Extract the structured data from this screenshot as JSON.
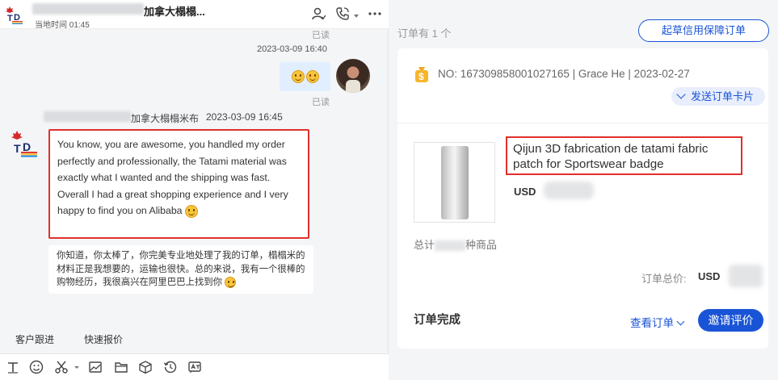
{
  "chat": {
    "header": {
      "contact_name": "加拿大榻榻...",
      "local_time": "当地时间 01:45",
      "icons": [
        "add-contact-icon",
        "call-icon",
        "more-icon"
      ]
    },
    "messages": {
      "read_top": "已读",
      "own_time": "2023-03-09 16:40",
      "read_own": "已读",
      "buyer_name": "加拿大榻榻米布",
      "buyer_time": "2023-03-09 16:45",
      "buyer_text": "You know, you are awesome, you handled my order perfectly and professionally, the Tatami material was exactly what I wanted and the shipping was fast. Overall I had a great shopping experience and I very happy to find you on Alibaba",
      "translation": "你知道，你太棒了，你完美专业地处理了我的订单，榻榻米的材料正是我想要的，运输也很快。总的来说，我有一个很棒的购物经历，我很高兴在阿里巴巴上找到你"
    },
    "quick_actions": [
      "客户跟进",
      "快速报价"
    ],
    "toolbar_icons": [
      "text-format-icon",
      "emoji-icon",
      "scissors-icon",
      "image-icon",
      "folder-icon",
      "package-icon",
      "history-icon",
      "translate-icon"
    ]
  },
  "order": {
    "count_label": "订单有 1 个",
    "draft_button": "起草信用保障订单",
    "meta": "NO: 167309858001027165 | Grace He | 2023-02-27",
    "send_card_button": "发送订单卡片",
    "product_title": "Qijun 3D fabrication de tatami fabric patch for Sportswear badge",
    "price_currency": "USD",
    "total_prefix": "总计",
    "total_suffix": "种商品",
    "order_total_label": "订单总价:",
    "order_total_currency": "USD",
    "status": "订单完成",
    "view_order": "查看订单",
    "review_button": "邀请评价"
  },
  "colors": {
    "accent_blue": "#1a54d6",
    "highlight_red": "#e0302c",
    "own_bubble": "#e1eeff"
  }
}
